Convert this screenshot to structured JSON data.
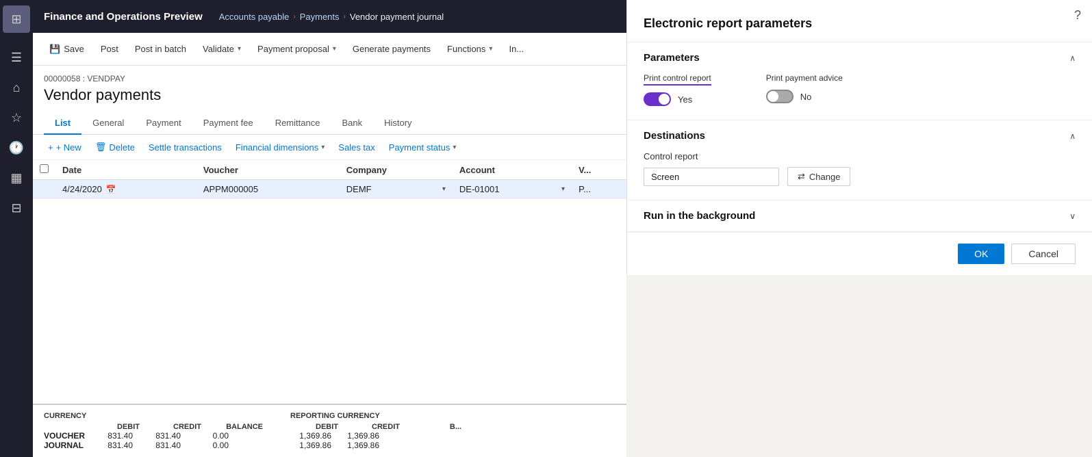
{
  "app": {
    "title": "Finance and Operations Preview"
  },
  "topbar": {
    "breadcrumb": [
      "Accounts payable",
      "Payments",
      "Vendor payment journal"
    ]
  },
  "toolbar": {
    "save_label": "Save",
    "post_label": "Post",
    "post_batch_label": "Post in batch",
    "validate_label": "Validate",
    "payment_proposal_label": "Payment proposal",
    "generate_payments_label": "Generate payments",
    "functions_label": "Functions",
    "inquiry_label": "In..."
  },
  "journal": {
    "id": "00000058 : VENDPAY",
    "title": "Vendor payments"
  },
  "tabs": [
    {
      "label": "List",
      "active": true
    },
    {
      "label": "General",
      "active": false
    },
    {
      "label": "Payment",
      "active": false
    },
    {
      "label": "Payment fee",
      "active": false
    },
    {
      "label": "Remittance",
      "active": false
    },
    {
      "label": "Bank",
      "active": false
    },
    {
      "label": "History",
      "active": false
    }
  ],
  "sub_toolbar": {
    "new_label": "+ New",
    "delete_label": "Delete",
    "settle_label": "Settle transactions",
    "fin_dim_label": "Financial dimensions",
    "sales_tax_label": "Sales tax",
    "payment_status_label": "Payment status"
  },
  "table": {
    "columns": [
      "",
      "Date",
      "Voucher",
      "Company",
      "Account",
      "V..."
    ],
    "rows": [
      {
        "date": "4/24/2020",
        "voucher": "APPM000005",
        "company": "DEMF",
        "account": "DE-01001",
        "extra": "P..."
      }
    ]
  },
  "summary": {
    "currency_label": "CURRENCY",
    "reporting_currency_label": "REPORTING CURRENCY",
    "debit_label": "DEBIT",
    "credit_label": "CREDIT",
    "balance_label": "BALANCE",
    "voucher_label": "VOUCHER",
    "journal_label": "JOURNAL",
    "rows": [
      {
        "label": "VOUCHER",
        "debit": "831.40",
        "credit": "831.40",
        "balance": "0.00",
        "rep_debit": "1,369.86",
        "rep_credit": "1,369.86"
      },
      {
        "label": "JOURNAL",
        "debit": "831.40",
        "credit": "831.40",
        "balance": "0.00",
        "rep_debit": "1,369.86",
        "rep_credit": "1,369.86"
      }
    ]
  },
  "panel": {
    "title": "Electronic report parameters",
    "parameters_label": "Parameters",
    "print_control_label": "Print control report",
    "print_control_value": "Yes",
    "print_control_on": true,
    "print_advice_label": "Print payment advice",
    "print_advice_value": "No",
    "print_advice_on": false,
    "destinations_label": "Destinations",
    "control_report_label": "Control report",
    "screen_value": "Screen",
    "change_label": "Change",
    "run_background_label": "Run in the background",
    "ok_label": "OK",
    "cancel_label": "Cancel",
    "help_label": "?"
  },
  "sidebar": {
    "icons": [
      {
        "name": "apps-icon",
        "symbol": "⊞"
      },
      {
        "name": "hamburger-icon",
        "symbol": "☰"
      },
      {
        "name": "home-icon",
        "symbol": "⌂"
      },
      {
        "name": "favorites-icon",
        "symbol": "☆"
      },
      {
        "name": "recent-icon",
        "symbol": "🕐"
      },
      {
        "name": "dashboard-icon",
        "symbol": "▦"
      },
      {
        "name": "modules-icon",
        "symbol": "⊟"
      }
    ]
  }
}
